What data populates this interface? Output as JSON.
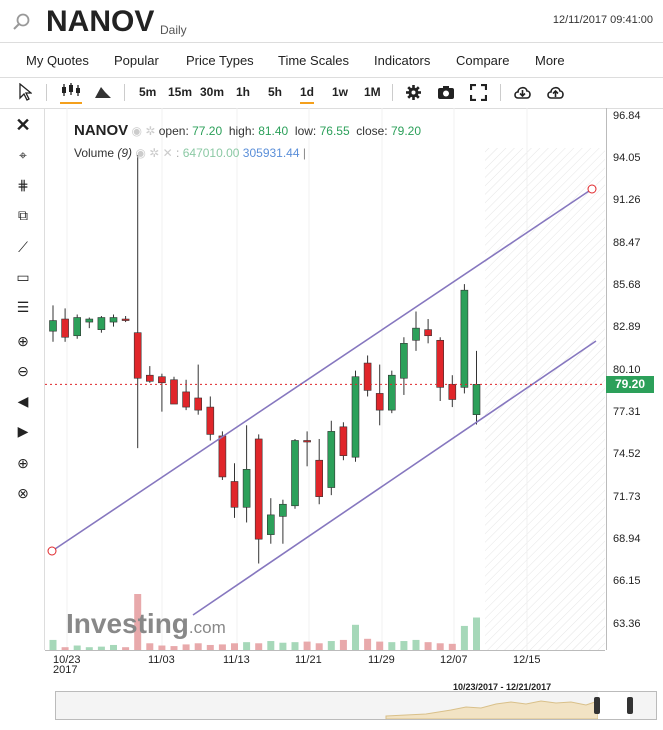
{
  "header": {
    "symbol": "NANOV",
    "period": "Daily",
    "datetime": "12/11/2017 09:41:00"
  },
  "menu": [
    "My Quotes",
    "Popular",
    "Price Types",
    "Time Scales",
    "Indicators",
    "Compare",
    "More"
  ],
  "toolbar": {
    "intervals": [
      "5m",
      "15m",
      "30m",
      "1h",
      "5h",
      "1d",
      "1w",
      "1M"
    ],
    "active": "1d"
  },
  "legend": {
    "symbol": "NANOV",
    "open_label": "open:",
    "open": "77.20",
    "high_label": "high:",
    "high": "81.40",
    "low_label": "low:",
    "low": "76.55",
    "close_label": "close:",
    "close": "79.20",
    "volume_label": "Volume",
    "volume_period": "(9)",
    "volume_value1": "647010.00",
    "volume_value2": "305931.44"
  },
  "last_price": "79.20",
  "watermark": {
    "brand": "Investing",
    "suffix": ".com"
  },
  "navigator": {
    "range": "10/23/2017 - 12/21/2017"
  },
  "colors": {
    "up": "#2ca05a",
    "down": "#e0262a",
    "channel": "#8677bf",
    "price_tag": "#2ca05a"
  },
  "chart_data": {
    "type": "candlestick",
    "y_ticks": [
      "96.84",
      "94.05",
      "91.26",
      "88.47",
      "85.68",
      "82.89",
      "80.10",
      "77.31",
      "74.52",
      "71.73",
      "68.94",
      "66.15",
      "63.36"
    ],
    "x_ticks": [
      "10/23",
      "11/03",
      "11/13",
      "11/21",
      "11/29",
      "12/07",
      "12/15"
    ],
    "x_first_year": "2017",
    "ylim": [
      61.7,
      97.4
    ],
    "last_price": 79.2,
    "candles": [
      {
        "o": 82.7,
        "h": 84.4,
        "l": 82.0,
        "c": 83.4
      },
      {
        "o": 83.5,
        "h": 84.2,
        "l": 82.0,
        "c": 82.3
      },
      {
        "o": 82.4,
        "h": 83.8,
        "l": 82.2,
        "c": 83.6
      },
      {
        "o": 83.3,
        "h": 83.6,
        "l": 82.9,
        "c": 83.5
      },
      {
        "o": 82.8,
        "h": 83.7,
        "l": 82.6,
        "c": 83.6
      },
      {
        "o": 83.3,
        "h": 83.8,
        "l": 83.0,
        "c": 83.6
      },
      {
        "o": 83.5,
        "h": 83.7,
        "l": 83.3,
        "c": 83.4
      },
      {
        "o": 82.6,
        "h": 94.3,
        "l": 75.0,
        "c": 79.6
      },
      {
        "o": 79.8,
        "h": 80.4,
        "l": 79.3,
        "c": 79.4
      },
      {
        "o": 79.7,
        "h": 79.9,
        "l": 77.4,
        "c": 79.3
      },
      {
        "o": 79.5,
        "h": 79.7,
        "l": 77.9,
        "c": 77.9
      },
      {
        "o": 78.7,
        "h": 79.5,
        "l": 77.5,
        "c": 77.7
      },
      {
        "o": 78.3,
        "h": 80.5,
        "l": 77.2,
        "c": 77.5
      },
      {
        "o": 77.7,
        "h": 78.4,
        "l": 75.5,
        "c": 75.9
      },
      {
        "o": 75.8,
        "h": 76.1,
        "l": 72.9,
        "c": 73.1
      },
      {
        "o": 72.8,
        "h": 74.0,
        "l": 70.4,
        "c": 71.1
      },
      {
        "o": 71.1,
        "h": 76.5,
        "l": 70.1,
        "c": 73.6
      },
      {
        "o": 75.6,
        "h": 75.9,
        "l": 67.4,
        "c": 69.0
      },
      {
        "o": 69.3,
        "h": 71.7,
        "l": 68.7,
        "c": 70.6
      },
      {
        "o": 70.5,
        "h": 71.6,
        "l": 68.7,
        "c": 71.3
      },
      {
        "o": 71.2,
        "h": 75.6,
        "l": 71.0,
        "c": 75.5
      },
      {
        "o": 75.5,
        "h": 76.1,
        "l": 73.8,
        "c": 75.4
      },
      {
        "o": 74.2,
        "h": 75.6,
        "l": 71.3,
        "c": 71.8
      },
      {
        "o": 72.4,
        "h": 76.8,
        "l": 71.9,
        "c": 76.1
      },
      {
        "o": 76.4,
        "h": 76.7,
        "l": 74.2,
        "c": 74.5
      },
      {
        "o": 74.4,
        "h": 80.1,
        "l": 74.1,
        "c": 79.7
      },
      {
        "o": 80.6,
        "h": 81.1,
        "l": 78.4,
        "c": 78.8
      },
      {
        "o": 78.6,
        "h": 80.5,
        "l": 76.5,
        "c": 77.5
      },
      {
        "o": 77.5,
        "h": 80.1,
        "l": 77.3,
        "c": 79.8
      },
      {
        "o": 79.6,
        "h": 82.3,
        "l": 78.5,
        "c": 81.9
      },
      {
        "o": 82.1,
        "h": 84.0,
        "l": 81.4,
        "c": 82.9
      },
      {
        "o": 82.8,
        "h": 83.5,
        "l": 81.9,
        "c": 82.4
      },
      {
        "o": 82.1,
        "h": 82.3,
        "l": 78.1,
        "c": 79.0
      },
      {
        "o": 79.2,
        "h": 79.8,
        "l": 77.7,
        "c": 78.2
      },
      {
        "o": 79.0,
        "h": 85.8,
        "l": 78.6,
        "c": 85.4
      },
      {
        "o": 77.2,
        "h": 81.4,
        "l": 76.55,
        "c": 79.2
      }
    ],
    "volume": [
      0.18,
      0.05,
      0.08,
      0.05,
      0.06,
      0.09,
      0.05,
      1.0,
      0.12,
      0.08,
      0.07,
      0.1,
      0.12,
      0.09,
      0.1,
      0.12,
      0.14,
      0.12,
      0.16,
      0.13,
      0.14,
      0.15,
      0.12,
      0.16,
      0.18,
      0.45,
      0.2,
      0.15,
      0.14,
      0.16,
      0.18,
      0.14,
      0.12,
      0.11,
      0.43,
      0.58
    ]
  }
}
